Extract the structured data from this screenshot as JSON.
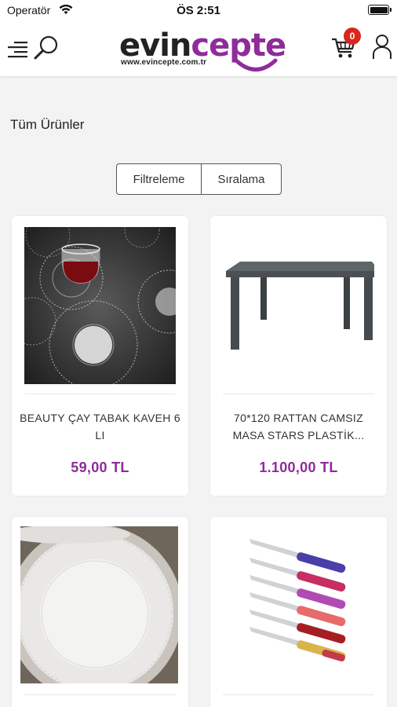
{
  "status_bar": {
    "carrier": "Operatör",
    "time": "ÖS 2:51"
  },
  "header": {
    "logo_text_dark": "evin",
    "logo_text_accent": "cepte",
    "logo_url": "www.evincepte.com.tr",
    "cart_count": "0",
    "brand_color": "#8e2c9a",
    "badge_color": "#d9271c",
    "icons": [
      "menu-icon",
      "search-icon",
      "cart-icon",
      "user-icon"
    ]
  },
  "page": {
    "title": "Tüm Ürünler"
  },
  "toolbar": {
    "filter_label": "Filtreleme",
    "sort_label": "Sıralama"
  },
  "products": [
    {
      "name": "BEAUTY ÇAY TABAK KAVEH 6 LI",
      "price": "59,00 TL"
    },
    {
      "name": "70*120 RATTAN CAMSIZ MASA STARS PLASTİK...",
      "price": "1.100,00 TL"
    },
    {
      "name": "",
      "price": ""
    },
    {
      "name": "",
      "price": ""
    }
  ]
}
